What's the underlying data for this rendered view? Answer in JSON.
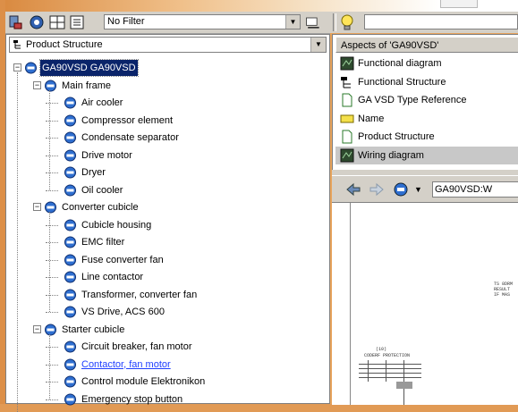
{
  "toolbar": {
    "filter_value": "No Filter",
    "icons": [
      "find-icon",
      "refresh-icon",
      "grid-icon",
      "filter-options-icon"
    ]
  },
  "structure_selector": {
    "value": "Product Structure"
  },
  "tree": {
    "root": "GA90VSD GA90VSD",
    "groups": [
      {
        "label": "Main frame",
        "items": [
          "Air cooler",
          "Compressor element",
          "Condensate separator",
          "Drive motor",
          "Dryer",
          "Oil cooler"
        ]
      },
      {
        "label": "Converter cubicle",
        "items": [
          "Cubicle housing",
          "EMC filter",
          "Fuse converter fan",
          "Line contactor",
          "Transformer, converter fan",
          "VS Drive, ACS 600"
        ]
      },
      {
        "label": "Starter cubicle",
        "items": [
          "Circuit breaker, fan motor",
          "Contactor, fan motor",
          "Control module Elektronikon",
          "Emergency stop button"
        ]
      }
    ]
  },
  "aspects": {
    "header": "Aspects of 'GA90VSD'",
    "items": [
      {
        "label": "Functional diagram",
        "icon": "diagram-icon"
      },
      {
        "label": "Functional Structure",
        "icon": "structure-icon"
      },
      {
        "label": "GA VSD Type Reference",
        "icon": "document-icon"
      },
      {
        "label": "Name",
        "icon": "name-tag-icon"
      },
      {
        "label": "Product Structure",
        "icon": "document-icon"
      },
      {
        "label": "Wiring diagram",
        "icon": "diagram-icon",
        "highlighted": true
      }
    ]
  },
  "navigation": {
    "path": "GA90VSD:W"
  },
  "diagram": {
    "labels": {
      "code": "(10)",
      "caption": "CODERF PROTECTION",
      "right_note_1": "TS 8DRM",
      "right_note_2": "RESULT",
      "right_note_3": "IF MAS"
    }
  },
  "colors": {
    "selection": "#0a246a",
    "link": "#1f3fff",
    "panel": "#d4d0c8",
    "background_orange": "#e8a45c"
  }
}
